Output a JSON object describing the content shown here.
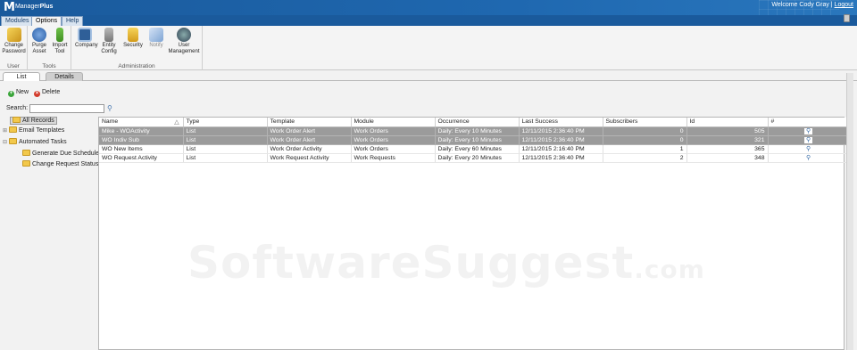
{
  "app": {
    "logo_letter": "M",
    "logo_name": "Manager",
    "logo_suffix": "Plus"
  },
  "header": {
    "welcome": "Welcome Cody Gray |",
    "logout": "Logout"
  },
  "module_tabs": [
    {
      "label": "Modules"
    },
    {
      "label": "Options"
    },
    {
      "label": "Help"
    }
  ],
  "ribbon": {
    "groups": [
      {
        "label": "User",
        "buttons": [
          {
            "label": "Change Password",
            "icon": "key-icon"
          }
        ]
      },
      {
        "label": "Tools",
        "buttons": [
          {
            "label": "Purge Asset",
            "icon": "purge-icon"
          },
          {
            "label": "Import Tool",
            "icon": "import-icon"
          }
        ]
      },
      {
        "label": "Administration",
        "buttons": [
          {
            "label": "Company",
            "icon": "company-icon"
          },
          {
            "label": "Entity Config",
            "icon": "entity-icon"
          },
          {
            "label": "Security",
            "icon": "lock-icon"
          },
          {
            "label": "Notify",
            "icon": "notify-icon"
          },
          {
            "label": "User Management",
            "icon": "users-icon"
          }
        ]
      }
    ]
  },
  "subtabs": [
    {
      "label": "List"
    },
    {
      "label": "Details"
    }
  ],
  "toolbar": {
    "new_label": "New",
    "delete_label": "Delete"
  },
  "search": {
    "label": "Search:",
    "value": ""
  },
  "tree": [
    {
      "label": "All Records",
      "selected": true
    },
    {
      "label": "Email Templates"
    },
    {
      "label": "Automated Tasks"
    },
    {
      "label": "Generate Due Schedules"
    },
    {
      "label": "Change Request Status"
    }
  ],
  "grid": {
    "columns": [
      "Name",
      "Type",
      "Template",
      "Module",
      "Occurrence",
      "Last Success",
      "Subscribers",
      "Id",
      "#"
    ],
    "rows": [
      {
        "name": "Mike - WOActivity",
        "type": "List",
        "template": "Work Order Alert",
        "module": "Work Orders",
        "occurrence": "Daily: Every 10 Minutes",
        "last_success": "12/11/2015 2:36:40 PM",
        "subscribers": "0",
        "id": "505",
        "dark": true
      },
      {
        "name": "WO Indiv Sub",
        "type": "List",
        "template": "Work Order Alert",
        "module": "Work Orders",
        "occurrence": "Daily: Every 10 Minutes",
        "last_success": "12/11/2015 2:36:40 PM",
        "subscribers": "0",
        "id": "321",
        "dark": true
      },
      {
        "name": "WO New Items",
        "type": "List",
        "template": "Work Order Activity",
        "module": "Work Orders",
        "occurrence": "Daily: Every 60 Minutes",
        "last_success": "12/11/2015 2:16:40 PM",
        "subscribers": "1",
        "id": "365",
        "dark": false
      },
      {
        "name": "WO Request Activity",
        "type": "List",
        "template": "Work Request Activity",
        "module": "Work Requests",
        "occurrence": "Daily: Every 20 Minutes",
        "last_success": "12/11/2015 2:36:40 PM",
        "subscribers": "2",
        "id": "348",
        "dark": false
      }
    ]
  },
  "watermark": {
    "main": "SoftwareSuggest",
    "suffix": ".com"
  }
}
